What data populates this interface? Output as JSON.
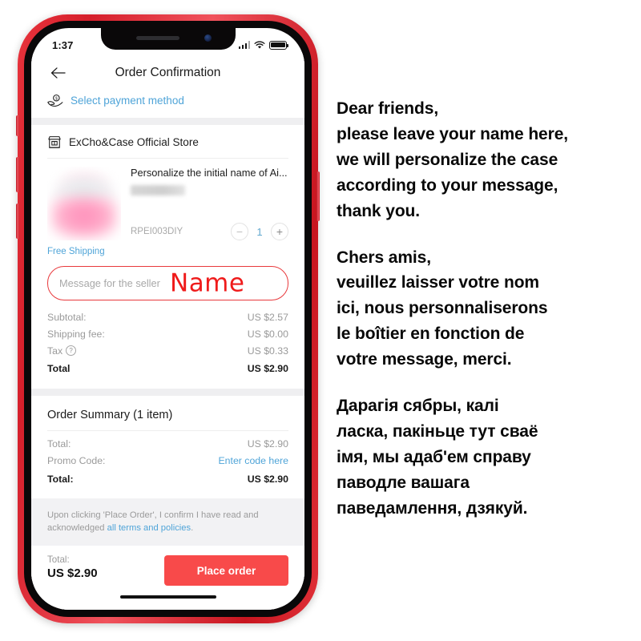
{
  "phone": {
    "status_bar": {
      "time": "1:37",
      "signal_icon": "cellular-signal-icon",
      "wifi_icon": "wifi-icon",
      "battery_icon": "battery-icon"
    },
    "nav": {
      "back_icon": "back-arrow-icon",
      "title": "Order Confirmation"
    },
    "payment": {
      "icon": "hand-holding-money-icon",
      "label": "Select payment method",
      "link_color": "#4fa4d8"
    },
    "store": {
      "icon": "storefront-icon",
      "name": "ExCho&Case Official Store"
    },
    "product": {
      "thumb_icon": "blurred-pink-airpods-case-image",
      "title": "Personalize the initial name of Ai...",
      "variant": "",
      "sku": "RPEI003DIY",
      "qty_minus": "−",
      "qty_value": "1",
      "qty_plus": "+",
      "free_shipping": "Free Shipping"
    },
    "message_field": {
      "placeholder": "Message for the seller",
      "annotation": "Name",
      "annotation_color": "#ef1b1b",
      "border_color": "#e8393c"
    },
    "price_lines": [
      {
        "label": "Subtotal:",
        "value": "US $2.57",
        "bold": false,
        "help": false
      },
      {
        "label": "Shipping fee:",
        "value": "US $0.00",
        "bold": false,
        "help": false
      },
      {
        "label": "Tax",
        "value": "US $0.33",
        "bold": false,
        "help": true
      },
      {
        "label": "Total",
        "value": "US $2.90",
        "bold": true,
        "help": false
      }
    ],
    "order_summary": {
      "title": "Order Summary (1 item)",
      "rows": [
        {
          "label": "Total:",
          "value": "US $2.90",
          "bold": false,
          "link": false
        },
        {
          "label": "Promo Code:",
          "value": "Enter code here",
          "bold": false,
          "link": true
        },
        {
          "label": "Total:",
          "value": "US $2.90",
          "bold": true,
          "link": false
        }
      ]
    },
    "terms": {
      "text_before": "Upon clicking 'Place Order', I confirm I have read and acknowledged ",
      "link": "all terms and policies",
      "text_after": "."
    },
    "bottom_bar": {
      "total_label": "Total:",
      "total_value": "US $2.90",
      "place_order_label": "Place order",
      "button_color": "#f84a4a"
    },
    "home_indicator": "home-indicator"
  },
  "instructions": {
    "blocks": [
      {
        "lines": [
          "Dear friends,",
          "please leave your name here,",
          "we will personalize the case",
          "according to your message,",
          "thank you."
        ]
      },
      {
        "lines": [
          "Chers amis,",
          "veuillez laisser votre nom",
          "ici, nous personnaliserons",
          "le boîtier en fonction de",
          "votre message, merci."
        ]
      },
      {
        "lines": [
          "Дарагія сябры, калі",
          "ласка, пакіньце тут сваё",
          "імя, мы адаб'ем справу",
          "паводле вашага",
          "паведамлення, дзякуй."
        ]
      }
    ]
  }
}
